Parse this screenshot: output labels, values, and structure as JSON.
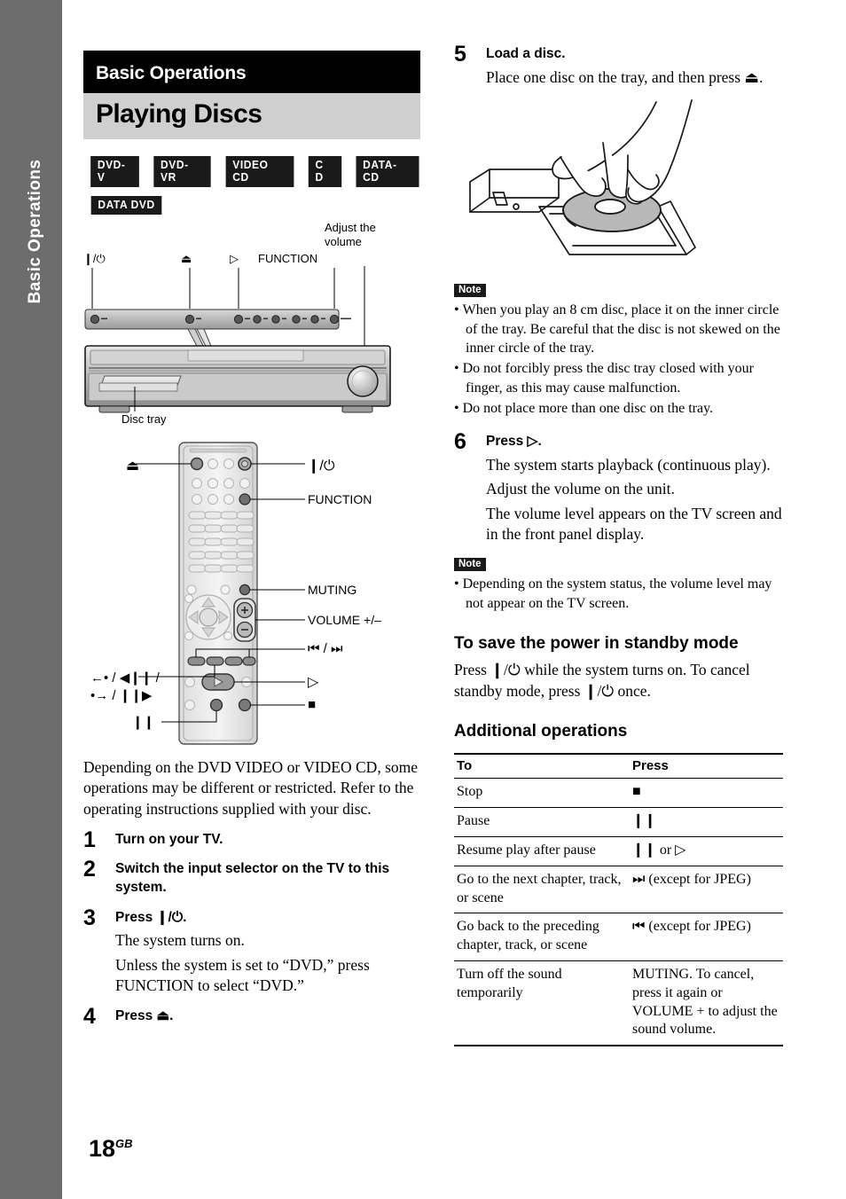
{
  "edge_tab": {
    "label": "Basic Operations"
  },
  "header": {
    "chapter": "Basic Operations",
    "title": "Playing Discs"
  },
  "disc_badges": {
    "row1": [
      "DVD-V",
      "DVD-VR",
      "VIDEO CD",
      "C D",
      "DATA-CD"
    ],
    "row2": [
      "DATA DVD"
    ]
  },
  "figure_front_panel": {
    "label_power": "❙/⏻",
    "label_eject": "⏏",
    "label_play": "▷",
    "label_function": "FUNCTION",
    "label_volume": "Adjust the volume",
    "label_disc_tray": "Disc tray"
  },
  "figure_remote": {
    "label_eject": "⏏",
    "label_power": "❙/⏻",
    "label_function": "FUNCTION",
    "label_muting": "MUTING",
    "label_volume": "VOLUME +/–",
    "label_skip": "⏮ / ⏭",
    "label_scan_line1": "←• / ◀❙❙ /",
    "label_scan_line2": "•→ / ❙❙▶",
    "label_play": "▷",
    "label_stop": "■",
    "label_pause": "❙❙"
  },
  "intro": "Depending on the DVD VIDEO or VIDEO CD, some operations may be different or restricted. Refer to the operating instructions supplied with your disc.",
  "steps": [
    {
      "num": "1",
      "title": "Turn on your TV.",
      "body": []
    },
    {
      "num": "2",
      "title": "Switch the input selector on the TV to this system.",
      "body": []
    },
    {
      "num": "3",
      "title": "Press ❙/⏻.",
      "body": [
        "The system turns on.",
        "Unless the system is set to “DVD,” press FUNCTION to select “DVD.”"
      ]
    },
    {
      "num": "4",
      "title": "Press ⏏.",
      "body": []
    },
    {
      "num": "5",
      "title": "Load a disc.",
      "body": [
        "Place one disc on the tray, and then press ⏏."
      ]
    },
    {
      "num": "6",
      "title": "Press ▷.",
      "body": [
        "The system starts playback (continuous play).",
        "Adjust the volume on the unit.",
        "The volume level appears on the TV screen and in the front panel display."
      ]
    }
  ],
  "note_disc": {
    "tag": "Note",
    "items": [
      "When you play an 8 cm disc, place it on the inner circle of the tray. Be careful that the disc is not skewed on the inner circle of the tray.",
      "Do not forcibly press the disc tray closed with your finger, as this may cause malfunction.",
      "Do not place more than one disc on the tray."
    ]
  },
  "note_volume": {
    "tag": "Note",
    "items": [
      "Depending on the system status, the volume level may not appear on the TV screen."
    ]
  },
  "standby": {
    "heading": "To save the power in standby mode",
    "body": "Press ❙/⏻ while the system turns on. To cancel standby mode, press ❙/⏻ once."
  },
  "additional": {
    "heading": "Additional operations",
    "table": {
      "columns": [
        "To",
        "Press"
      ],
      "rows": [
        {
          "to": "Stop",
          "press": "■"
        },
        {
          "to": "Pause",
          "press": "❙❙"
        },
        {
          "to": "Resume play after pause",
          "press": "❙❙ or ▷"
        },
        {
          "to": "Go to the next chapter, track, or scene",
          "press": "⏭ (except for JPEG)"
        },
        {
          "to": "Go back to the preceding chapter, track, or scene",
          "press": "⏮ (except for JPEG)"
        },
        {
          "to": "Turn off the sound temporarily",
          "press": "MUTING. To cancel, press it again or VOLUME + to adjust the sound volume."
        }
      ]
    }
  },
  "folio": {
    "page": "18",
    "region": "GB"
  }
}
